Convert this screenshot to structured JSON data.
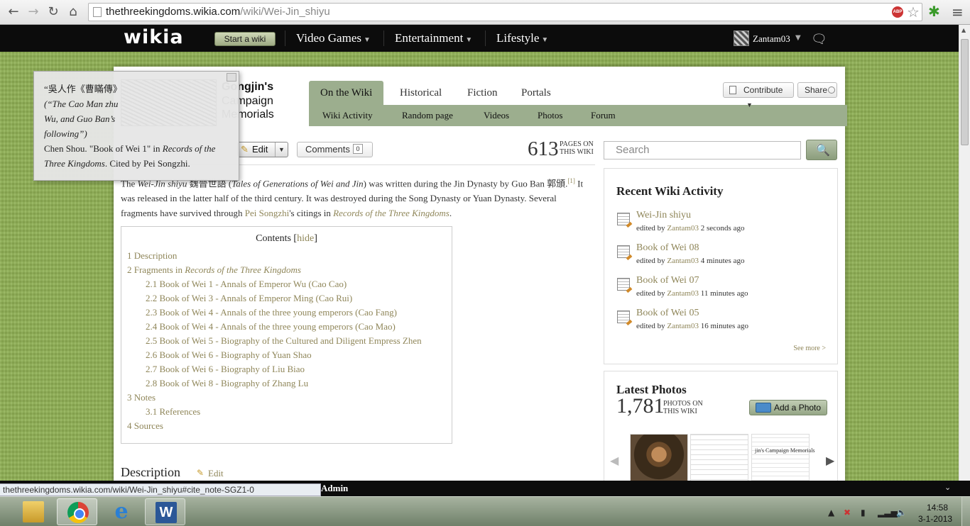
{
  "browser": {
    "url_host": "thethreekingdoms.wikia.com",
    "url_path": "/wiki/Wei-Jin_shiyu"
  },
  "wikia_nav": {
    "logo": "wikia",
    "start_wiki": "Start a wiki",
    "items": [
      "Video Games",
      "Entertainment",
      "Lifestyle"
    ],
    "username": "Zantam03"
  },
  "wiki": {
    "name_line1": "Gongjin's",
    "name_line2": "Campaign",
    "name_line3": "Memorials",
    "tabs": [
      "On the Wiki",
      "Historical",
      "Fiction",
      "Portals"
    ],
    "subnav": [
      "Wiki Activity",
      "Random page",
      "Videos",
      "Photos",
      "Forum"
    ],
    "contribute": "Contribute",
    "share": "Share",
    "page_count": "613",
    "page_count_label_1": "PAGES ON",
    "page_count_label_2": "THIS WIKI"
  },
  "article": {
    "edit": "Edit",
    "comments": "Comments",
    "comments_count": "0",
    "intro_1a": "The ",
    "intro_1b": "Wei-Jin shiyu",
    "intro_1c": " 魏晉世語 (",
    "intro_1d": "Tales of Generations of Wei and Jin",
    "intro_1e": ") was written during the Jin Dynasty by Guo Ban 郭頒.",
    "intro_sup": "[1]",
    "intro_2": " It was released in the latter half of the third century. It was destroyed during the Song Dynasty or Yuan Dynasty. Several fragments have survived through ",
    "intro_link_1": "Pei Songzhi",
    "intro_3": "'s citings in ",
    "intro_link_2": "Records of the Three Kingdoms",
    "intro_4": ".",
    "toc_title": "Contents",
    "toc_hide": "hide",
    "toc": [
      {
        "num": "1",
        "text": "Description",
        "italic": "",
        "level": 1
      },
      {
        "num": "2",
        "text": "Fragments in ",
        "italic": "Records of the Three Kingdoms",
        "level": 1
      },
      {
        "num": "2.1",
        "text": "Book of Wei 1 - Annals of Emperor Wu (Cao Cao)",
        "italic": "",
        "level": 2
      },
      {
        "num": "2.2",
        "text": "Book of Wei 3 - Annals of Emperor Ming (Cao Rui)",
        "italic": "",
        "level": 2
      },
      {
        "num": "2.3",
        "text": "Book of Wei 4 - Annals of the three young emperors (Cao Fang)",
        "italic": "",
        "level": 2
      },
      {
        "num": "2.4",
        "text": "Book of Wei 4 - Annals of the three young emperors (Cao Mao)",
        "italic": "",
        "level": 2
      },
      {
        "num": "2.5",
        "text": "Book of Wei 5 - Biography of the Cultured and Diligent Empress Zhen",
        "italic": "",
        "level": 2
      },
      {
        "num": "2.6",
        "text": "Book of Wei 6 - Biography of Yuan Shao",
        "italic": "",
        "level": 2
      },
      {
        "num": "2.7",
        "text": "Book of Wei 6 - Biography of Liu Biao",
        "italic": "",
        "level": 2
      },
      {
        "num": "2.8",
        "text": "Book of Wei 8 - Biography of Zhang Lu",
        "italic": "",
        "level": 2
      },
      {
        "num": "3",
        "text": "Notes",
        "italic": "",
        "level": 1
      },
      {
        "num": "3.1",
        "text": "References",
        "italic": "",
        "level": 2
      },
      {
        "num": "4",
        "text": "Sources",
        "italic": "",
        "level": 1
      }
    ],
    "section_heading": "Description",
    "section_edit": "Edit"
  },
  "rail": {
    "search_placeholder": "Search",
    "activity_title": "Recent Wiki Activity",
    "activity": [
      {
        "title": "Wei-Jin shiyu",
        "prefix": "edited by ",
        "user": "Zantam03",
        "time": " 2 seconds ago"
      },
      {
        "title": "Book of Wei 08",
        "prefix": "edited by ",
        "user": "Zantam03",
        "time": " 4 minutes ago"
      },
      {
        "title": "Book of Wei 07",
        "prefix": "edited by ",
        "user": "Zantam03",
        "time": " 11 minutes ago"
      },
      {
        "title": "Book of Wei 05",
        "prefix": "edited by ",
        "user": "Zantam03",
        "time": " 16 minutes ago"
      }
    ],
    "see_more": "See more >",
    "photos_title": "Latest Photos",
    "photos_count": "1,781",
    "photos_label_1": "PHOTOS ON",
    "photos_label_2": "THIS WIKI",
    "add_photo": "Add a Photo",
    "thumb3_caption": "jin's Campaign Memorials"
  },
  "tooltip": {
    "line1": "“吳人作《曹瞞傳》",
    "line2": "(“The Cao Man zhu",
    "line3": "Wu, and Guo Ban’s",
    "line4": "following”)",
    "line5a": "Chen Shou. \"Book of Wei 1\" in ",
    "line5b": "Records of the Three Kingdoms",
    "line5c": ". Cited by Pei Songzhi."
  },
  "toolbar": {
    "admin": "Admin",
    "status_url": "thethreekingdoms.wikia.com/wiki/Wei-Jin_shiyu#cite_note-SGZ1-0"
  },
  "taskbar": {
    "time": "14:58",
    "date": "3-1-2013"
  }
}
